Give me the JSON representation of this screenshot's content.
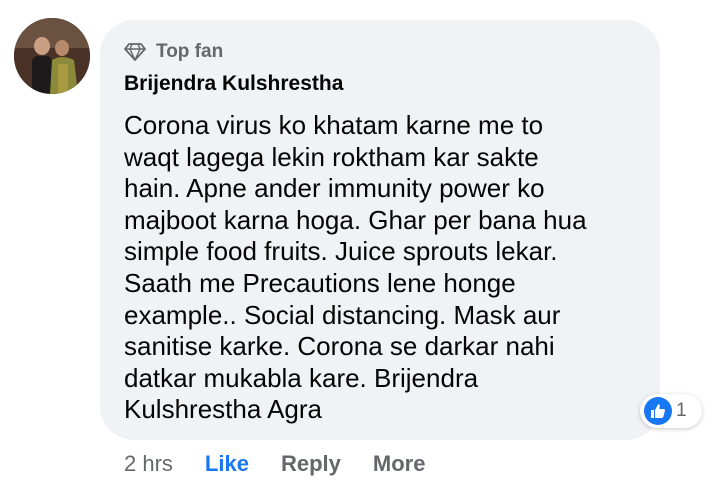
{
  "comment": {
    "badge": "Top fan",
    "badge_icon": "diamond-icon",
    "author": "Brijendra Kulshrestha",
    "text": "Corona virus ko khatam karne me to\nwaqt lagega lekin roktham kar sakte\nhain. Apne ander immunity power ko\nmajboot karna hoga. Ghar per bana hua\nsimple food fruits. Juice sprouts lekar.\nSaath me Precautions lene honge\nexample.. Social distancing. Mask aur\nsanitise karke. Corona se darkar nahi\ndatkar mukabla kare. Brijendra\nKulshrestha Agra",
    "reactions": {
      "icon": "like-icon",
      "count": "1"
    }
  },
  "actions": {
    "time": "2 hrs",
    "like": "Like",
    "reply": "Reply",
    "more": "More"
  },
  "colors": {
    "bubble_bg": "#f0f2f5",
    "accent": "#1877f2",
    "secondary_text": "#65676b",
    "primary_text": "#050505"
  }
}
